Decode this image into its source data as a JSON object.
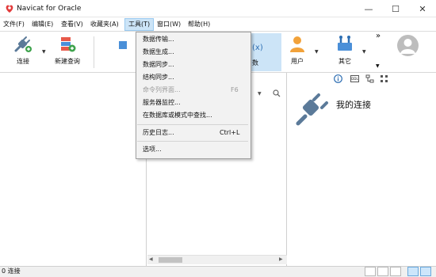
{
  "app": {
    "title": "Navicat for Oracle"
  },
  "window_controls": {
    "minimize": "—",
    "maximize": "☐",
    "close": "✕"
  },
  "menu": [
    {
      "label": "文件(F)"
    },
    {
      "label": "编辑(E)"
    },
    {
      "label": "查看(V)"
    },
    {
      "label": "收藏夹(A)"
    },
    {
      "label": "工具(T)"
    },
    {
      "label": "窗口(W)"
    },
    {
      "label": "帮助(H)"
    }
  ],
  "toolbar": {
    "connect": "连接",
    "new_query": "新建查询",
    "function_partial": "数",
    "user": "用户",
    "other": "其它",
    "more": "»"
  },
  "tools_menu": {
    "items": [
      {
        "label": "数据传输...",
        "shortcut": "",
        "disabled": false
      },
      {
        "label": "数据生成...",
        "shortcut": "",
        "disabled": false
      },
      {
        "label": "数据同步...",
        "shortcut": "",
        "disabled": false
      },
      {
        "label": "结构同步...",
        "shortcut": "",
        "disabled": false
      },
      {
        "label": "命令列界面...",
        "shortcut": "F6",
        "disabled": true
      },
      {
        "label": "服务器监控...",
        "shortcut": "",
        "disabled": false
      },
      {
        "label": "在数据库或模式中查找...",
        "shortcut": "",
        "disabled": false
      },
      {
        "label": "历史日志...",
        "shortcut": "Ctrl+L",
        "disabled": false
      },
      {
        "label": "选项...",
        "shortcut": "",
        "disabled": false
      }
    ]
  },
  "right_panel": {
    "title": "我的连接"
  },
  "status": {
    "text": "0 连接"
  },
  "colors": {
    "accent": "#cce4f7",
    "plug": "#5b7a99",
    "green": "#3fa34d"
  }
}
